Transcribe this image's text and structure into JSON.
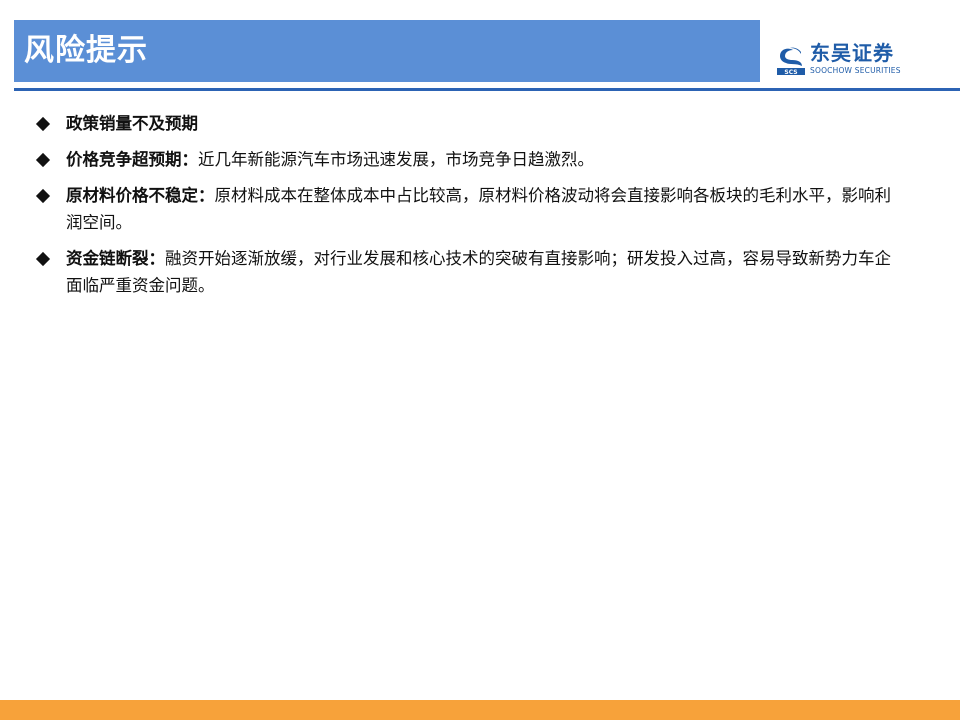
{
  "header": {
    "title": "风险提示"
  },
  "logo": {
    "name": "东吴证券",
    "english": "SOOCHOW SECURITIES",
    "mark_letters": "SCS"
  },
  "bullets": [
    {
      "label": "政策销量不及预期",
      "text": ""
    },
    {
      "label": "价格竞争超预期：",
      "text": "近几年新能源汽车市场迅速发展，市场竞争日趋激烈。"
    },
    {
      "label": "原材料价格不稳定：",
      "text": "原材料成本在整体成本中占比较高，原材料价格波动将会直接影响各板块的毛利水平，影响利润空间。"
    },
    {
      "label": "资金链断裂：",
      "text": "融资开始逐渐放缓，对行业发展和核心技术的突破有直接影响；研发投入过高，容易导致新势力车企面临严重资金问题。"
    }
  ],
  "colors": {
    "title_bar": "#5b8fd6",
    "divider": "#2c63b4",
    "footer": "#f7a23a",
    "brand": "#1f5ca8"
  }
}
